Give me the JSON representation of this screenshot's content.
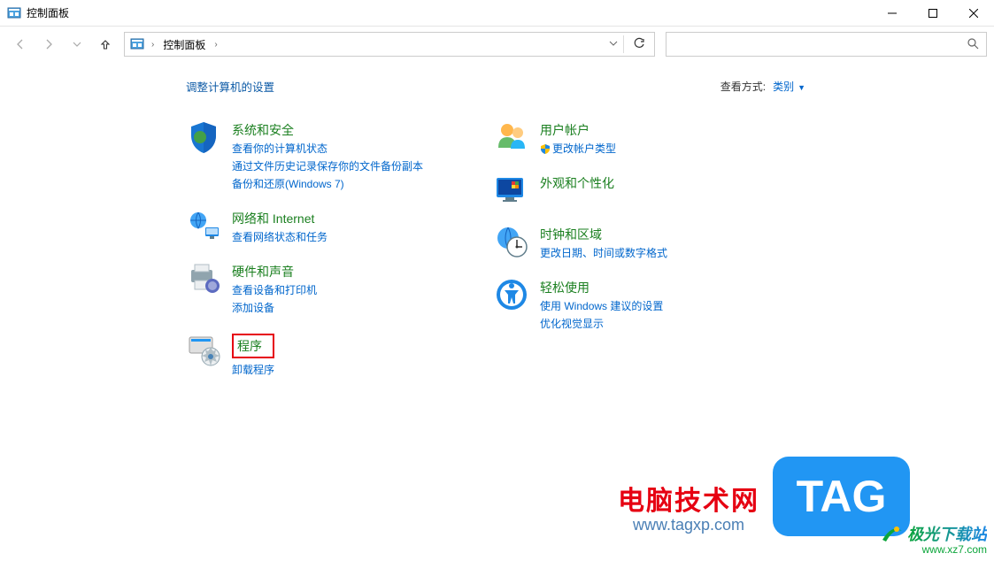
{
  "window": {
    "title": "控制面板"
  },
  "breadcrumb": {
    "root": "控制面板"
  },
  "search": {
    "placeholder": ""
  },
  "content": {
    "heading": "调整计算机的设置",
    "view_by_label": "查看方式:",
    "view_by_value": "类别"
  },
  "categories": {
    "left": [
      {
        "title": "系统和安全",
        "links": [
          "查看你的计算机状态",
          "通过文件历史记录保存你的文件备份副本",
          "备份和还原(Windows 7)"
        ]
      },
      {
        "title": "网络和 Internet",
        "links": [
          "查看网络状态和任务"
        ]
      },
      {
        "title": "硬件和声音",
        "links": [
          "查看设备和打印机",
          "添加设备"
        ]
      },
      {
        "title": "程序",
        "links": [
          "卸载程序"
        ],
        "highlighted": true
      }
    ],
    "right": [
      {
        "title": "用户帐户",
        "links": [
          "更改帐户类型"
        ],
        "shielded": [
          0
        ]
      },
      {
        "title": "外观和个性化",
        "links": []
      },
      {
        "title": "时钟和区域",
        "links": [
          "更改日期、时间或数字格式"
        ]
      },
      {
        "title": "轻松使用",
        "links": [
          "使用 Windows 建议的设置",
          "优化视觉显示"
        ]
      }
    ]
  },
  "watermarks": {
    "wm1_top": "电脑技术网",
    "wm1_bottom": "www.tagxp.com",
    "tag": "TAG",
    "wm2_name": "极光下载站",
    "wm2_url": "www.xz7.com"
  }
}
